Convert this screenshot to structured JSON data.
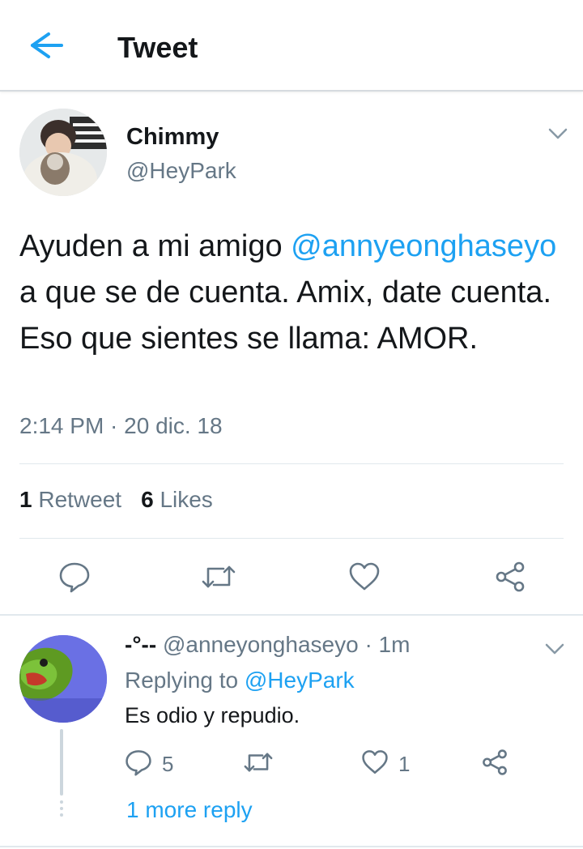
{
  "header": {
    "title": "Tweet",
    "back_icon": "arrow-left-icon",
    "accent_color": "#1da1f2"
  },
  "tweet": {
    "author_name": "Chimmy",
    "author_handle": "@HeyPark",
    "text_before": "Ayuden a mi amigo ",
    "mention": "@annyeonghaseyo",
    "text_after": " a que se de cuenta. Amix, date cuenta. Eso que sientes se llama: AMOR.",
    "timestamp": "2:14 PM · 20 dic. 18",
    "retweets_count": "1",
    "retweets_label": "Retweet",
    "likes_count": "6",
    "likes_label": "Likes",
    "actions": [
      "reply-icon",
      "retweet-icon",
      "like-icon",
      "share-icon"
    ]
  },
  "reply": {
    "author_name": "-°--",
    "author_handle": "@anneyonghaseyo",
    "time": "· 1m",
    "replying_prefix": "Replying to ",
    "replying_to": "@HeyPark",
    "text": "Es odio y repudio.",
    "reply_count": "5",
    "like_count": "1",
    "more_replies": "1 more reply"
  },
  "colors": {
    "text_primary": "#14171a",
    "text_secondary": "#657786",
    "divider": "#e1e8ed",
    "link": "#1da1f2"
  }
}
